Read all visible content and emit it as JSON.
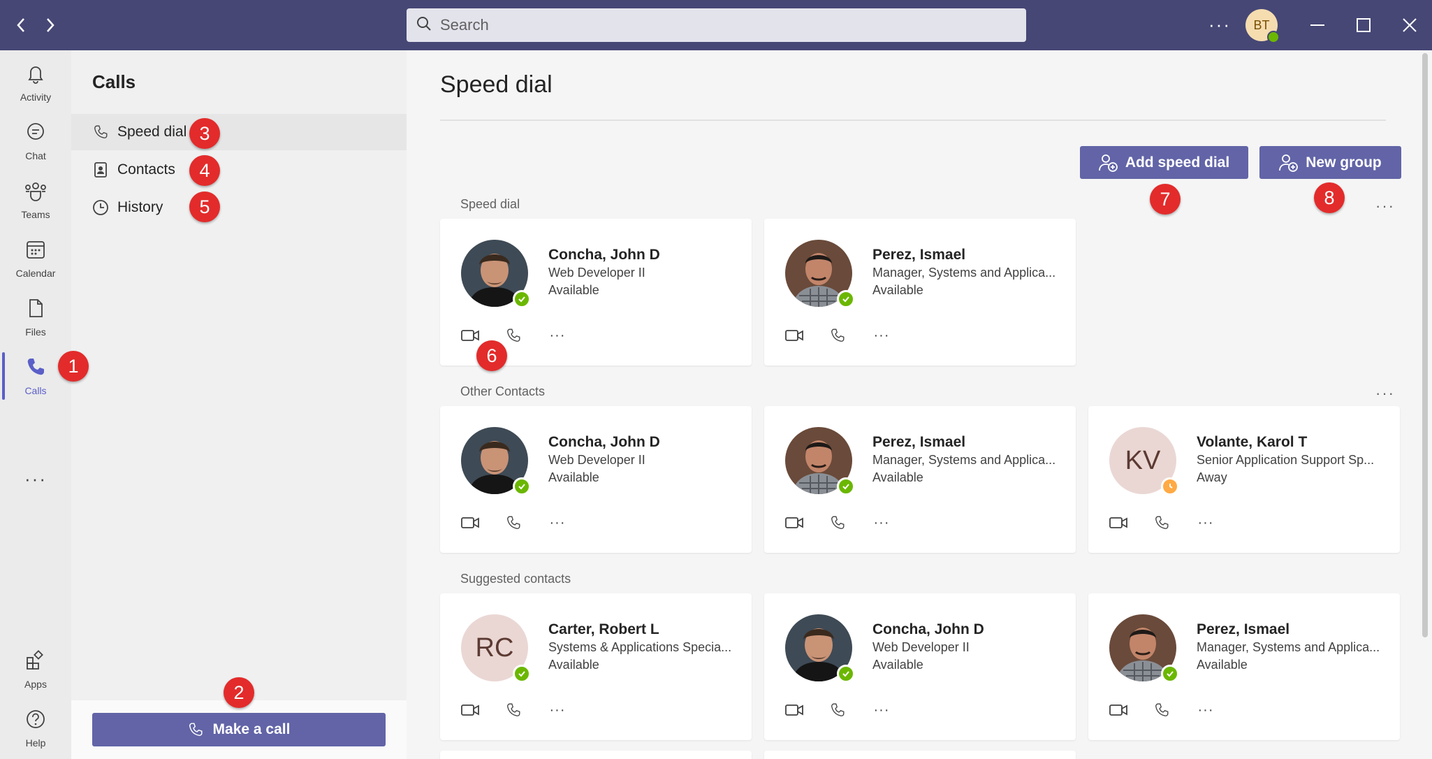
{
  "search": {
    "placeholder": "Search"
  },
  "titlebar": {
    "more": "···",
    "avatar_initials": "BT"
  },
  "rail": [
    {
      "label": "Activity",
      "icon": "bell-icon"
    },
    {
      "label": "Chat",
      "icon": "chat-icon"
    },
    {
      "label": "Teams",
      "icon": "teams-icon"
    },
    {
      "label": "Calendar",
      "icon": "calendar-icon"
    },
    {
      "label": "Files",
      "icon": "files-icon"
    },
    {
      "label": "Calls",
      "icon": "phone-icon",
      "active": true
    },
    {
      "label": "Apps",
      "icon": "apps-icon"
    },
    {
      "label": "Help",
      "icon": "help-icon"
    }
  ],
  "rail_more": "···",
  "panel": {
    "title": "Calls",
    "nav": [
      {
        "label": "Speed dial",
        "icon": "phone-icon"
      },
      {
        "label": "Contacts",
        "icon": "contacts-icon"
      },
      {
        "label": "History",
        "icon": "clock-icon"
      }
    ],
    "make_call": "Make a call"
  },
  "main": {
    "title": "Speed dial",
    "add_speed_dial": "Add speed dial",
    "new_group": "New group",
    "more": "···",
    "sections": [
      {
        "title": "Speed dial",
        "cards": [
          {
            "name": "Concha, John D",
            "role": "Web Developer II",
            "status": "Available",
            "avatar": "photo-a"
          },
          {
            "name": "Perez, Ismael",
            "role": "Manager, Systems and Applica...",
            "status": "Available",
            "avatar": "photo-b"
          }
        ]
      },
      {
        "title": "Other Contacts",
        "cards": [
          {
            "name": "Concha, John D",
            "role": "Web Developer II",
            "status": "Available",
            "avatar": "photo-a"
          },
          {
            "name": "Perez, Ismael",
            "role": "Manager, Systems and Applica...",
            "status": "Available",
            "avatar": "photo-b"
          },
          {
            "name": "Volante, Karol T",
            "role": "Senior Application Support Sp...",
            "status": "Away",
            "avatar": "KV"
          }
        ]
      },
      {
        "title": "Suggested contacts",
        "cards": [
          {
            "name": "Carter, Robert L",
            "role": "Systems & Applications Specia...",
            "status": "Available",
            "avatar": "RC"
          },
          {
            "name": "Concha, John D",
            "role": "Web Developer II",
            "status": "Available",
            "avatar": "photo-a"
          },
          {
            "name": "Perez, Ismael",
            "role": "Manager, Systems and Applica...",
            "status": "Available",
            "avatar": "photo-b"
          }
        ]
      }
    ]
  },
  "badges": [
    "1",
    "2",
    "3",
    "4",
    "5",
    "6",
    "7",
    "8"
  ],
  "colors": {
    "titlebar": "#464775",
    "accent": "#6264a7",
    "available": "#6bb700",
    "away": "#ffaa44",
    "badge": "#e32b2b"
  }
}
